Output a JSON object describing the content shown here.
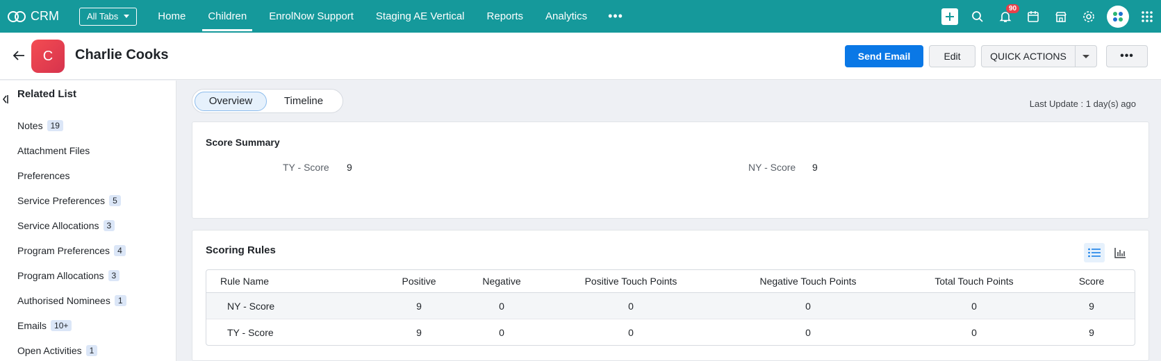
{
  "app": {
    "name": "CRM"
  },
  "nav": {
    "all_tabs": "All Tabs",
    "tabs": [
      {
        "label": "Home",
        "active": false
      },
      {
        "label": "Children",
        "active": true
      },
      {
        "label": "EnrolNow Support",
        "active": false
      },
      {
        "label": "Staging AE Vertical",
        "active": false
      },
      {
        "label": "Reports",
        "active": false
      },
      {
        "label": "Analytics",
        "active": false
      }
    ],
    "more": "•••",
    "notification_count": "90",
    "icons": [
      "plus-icon",
      "search-icon",
      "bell-icon",
      "calendar-icon",
      "store-icon",
      "gear-icon",
      "profile-avatar",
      "apps-grid-icon"
    ]
  },
  "record": {
    "initial": "C",
    "name": "Charlie Cooks",
    "actions": {
      "send_email": "Send Email",
      "edit": "Edit",
      "quick_actions": "QUICK ACTIONS",
      "more": "•••"
    }
  },
  "sidebar": {
    "title": "Related List",
    "items": [
      {
        "label": "Notes",
        "count": "19"
      },
      {
        "label": "Attachment Files",
        "count": ""
      },
      {
        "label": "Preferences",
        "count": ""
      },
      {
        "label": "Service Preferences",
        "count": "5"
      },
      {
        "label": "Service Allocations",
        "count": "3"
      },
      {
        "label": "Program Preferences",
        "count": "4"
      },
      {
        "label": "Program Allocations",
        "count": "3"
      },
      {
        "label": "Authorised Nominees",
        "count": "1"
      },
      {
        "label": "Emails",
        "count": "10+"
      },
      {
        "label": "Open Activities",
        "count": "1"
      }
    ]
  },
  "view_tabs": {
    "overview": "Overview",
    "timeline": "Timeline"
  },
  "last_update": "Last Update : 1 day(s) ago",
  "score_summary": {
    "title": "Score Summary",
    "fields": [
      {
        "label": "TY - Score",
        "value": "9"
      },
      {
        "label": "NY - Score",
        "value": "9"
      }
    ]
  },
  "scoring_rules": {
    "title": "Scoring Rules",
    "columns": [
      "Rule Name",
      "Positive",
      "Negative",
      "Positive Touch Points",
      "Negative Touch Points",
      "Total Touch Points",
      "Score"
    ],
    "rows": [
      [
        "NY - Score",
        "9",
        "0",
        "0",
        "0",
        "0",
        "9"
      ],
      [
        "TY - Score",
        "9",
        "0",
        "0",
        "0",
        "0",
        "9"
      ]
    ]
  },
  "colors": {
    "topbar": "#15999b",
    "primary": "#0a78e6",
    "avatar": "#e8404a"
  }
}
